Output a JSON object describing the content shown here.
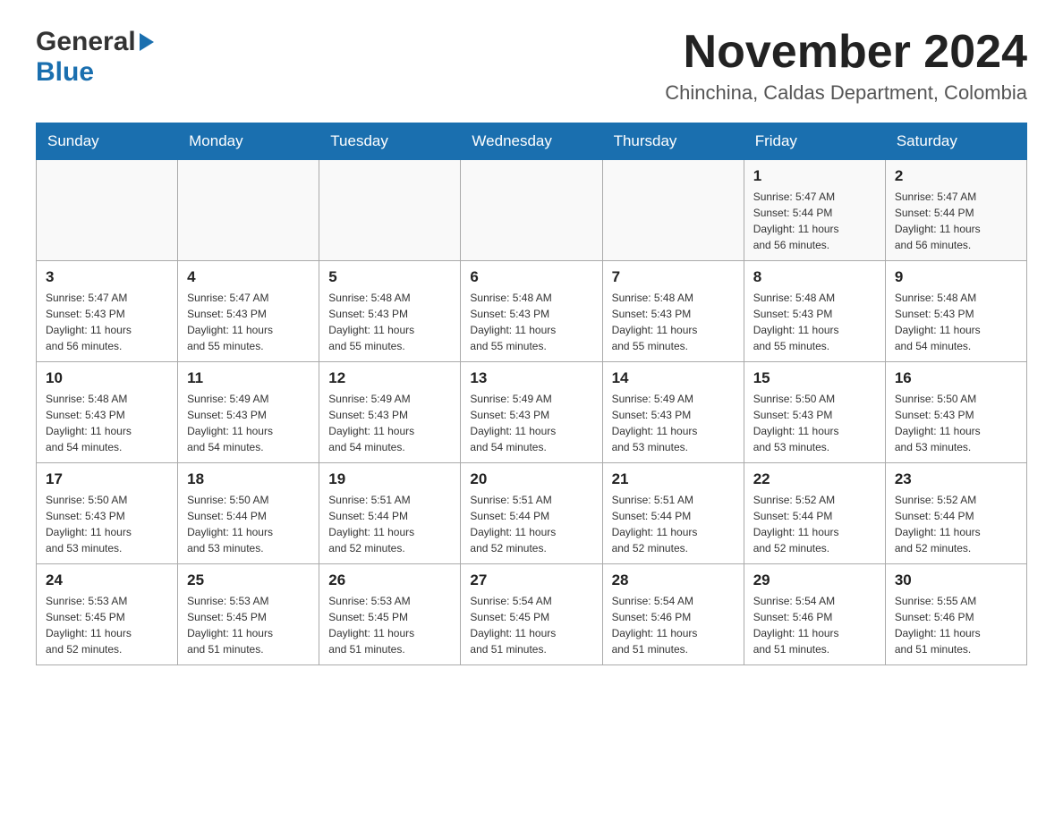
{
  "header": {
    "logo": {
      "general": "General",
      "blue": "Blue",
      "arrow": "▶"
    },
    "month_title": "November 2024",
    "location": "Chinchina, Caldas Department, Colombia"
  },
  "calendar": {
    "days_of_week": [
      "Sunday",
      "Monday",
      "Tuesday",
      "Wednesday",
      "Thursday",
      "Friday",
      "Saturday"
    ],
    "weeks": [
      [
        {
          "day": "",
          "info": ""
        },
        {
          "day": "",
          "info": ""
        },
        {
          "day": "",
          "info": ""
        },
        {
          "day": "",
          "info": ""
        },
        {
          "day": "",
          "info": ""
        },
        {
          "day": "1",
          "info": "Sunrise: 5:47 AM\nSunset: 5:44 PM\nDaylight: 11 hours\nand 56 minutes."
        },
        {
          "day": "2",
          "info": "Sunrise: 5:47 AM\nSunset: 5:44 PM\nDaylight: 11 hours\nand 56 minutes."
        }
      ],
      [
        {
          "day": "3",
          "info": "Sunrise: 5:47 AM\nSunset: 5:43 PM\nDaylight: 11 hours\nand 56 minutes."
        },
        {
          "day": "4",
          "info": "Sunrise: 5:47 AM\nSunset: 5:43 PM\nDaylight: 11 hours\nand 55 minutes."
        },
        {
          "day": "5",
          "info": "Sunrise: 5:48 AM\nSunset: 5:43 PM\nDaylight: 11 hours\nand 55 minutes."
        },
        {
          "day": "6",
          "info": "Sunrise: 5:48 AM\nSunset: 5:43 PM\nDaylight: 11 hours\nand 55 minutes."
        },
        {
          "day": "7",
          "info": "Sunrise: 5:48 AM\nSunset: 5:43 PM\nDaylight: 11 hours\nand 55 minutes."
        },
        {
          "day": "8",
          "info": "Sunrise: 5:48 AM\nSunset: 5:43 PM\nDaylight: 11 hours\nand 55 minutes."
        },
        {
          "day": "9",
          "info": "Sunrise: 5:48 AM\nSunset: 5:43 PM\nDaylight: 11 hours\nand 54 minutes."
        }
      ],
      [
        {
          "day": "10",
          "info": "Sunrise: 5:48 AM\nSunset: 5:43 PM\nDaylight: 11 hours\nand 54 minutes."
        },
        {
          "day": "11",
          "info": "Sunrise: 5:49 AM\nSunset: 5:43 PM\nDaylight: 11 hours\nand 54 minutes."
        },
        {
          "day": "12",
          "info": "Sunrise: 5:49 AM\nSunset: 5:43 PM\nDaylight: 11 hours\nand 54 minutes."
        },
        {
          "day": "13",
          "info": "Sunrise: 5:49 AM\nSunset: 5:43 PM\nDaylight: 11 hours\nand 54 minutes."
        },
        {
          "day": "14",
          "info": "Sunrise: 5:49 AM\nSunset: 5:43 PM\nDaylight: 11 hours\nand 53 minutes."
        },
        {
          "day": "15",
          "info": "Sunrise: 5:50 AM\nSunset: 5:43 PM\nDaylight: 11 hours\nand 53 minutes."
        },
        {
          "day": "16",
          "info": "Sunrise: 5:50 AM\nSunset: 5:43 PM\nDaylight: 11 hours\nand 53 minutes."
        }
      ],
      [
        {
          "day": "17",
          "info": "Sunrise: 5:50 AM\nSunset: 5:43 PM\nDaylight: 11 hours\nand 53 minutes."
        },
        {
          "day": "18",
          "info": "Sunrise: 5:50 AM\nSunset: 5:44 PM\nDaylight: 11 hours\nand 53 minutes."
        },
        {
          "day": "19",
          "info": "Sunrise: 5:51 AM\nSunset: 5:44 PM\nDaylight: 11 hours\nand 52 minutes."
        },
        {
          "day": "20",
          "info": "Sunrise: 5:51 AM\nSunset: 5:44 PM\nDaylight: 11 hours\nand 52 minutes."
        },
        {
          "day": "21",
          "info": "Sunrise: 5:51 AM\nSunset: 5:44 PM\nDaylight: 11 hours\nand 52 minutes."
        },
        {
          "day": "22",
          "info": "Sunrise: 5:52 AM\nSunset: 5:44 PM\nDaylight: 11 hours\nand 52 minutes."
        },
        {
          "day": "23",
          "info": "Sunrise: 5:52 AM\nSunset: 5:44 PM\nDaylight: 11 hours\nand 52 minutes."
        }
      ],
      [
        {
          "day": "24",
          "info": "Sunrise: 5:53 AM\nSunset: 5:45 PM\nDaylight: 11 hours\nand 52 minutes."
        },
        {
          "day": "25",
          "info": "Sunrise: 5:53 AM\nSunset: 5:45 PM\nDaylight: 11 hours\nand 51 minutes."
        },
        {
          "day": "26",
          "info": "Sunrise: 5:53 AM\nSunset: 5:45 PM\nDaylight: 11 hours\nand 51 minutes."
        },
        {
          "day": "27",
          "info": "Sunrise: 5:54 AM\nSunset: 5:45 PM\nDaylight: 11 hours\nand 51 minutes."
        },
        {
          "day": "28",
          "info": "Sunrise: 5:54 AM\nSunset: 5:46 PM\nDaylight: 11 hours\nand 51 minutes."
        },
        {
          "day": "29",
          "info": "Sunrise: 5:54 AM\nSunset: 5:46 PM\nDaylight: 11 hours\nand 51 minutes."
        },
        {
          "day": "30",
          "info": "Sunrise: 5:55 AM\nSunset: 5:46 PM\nDaylight: 11 hours\nand 51 minutes."
        }
      ]
    ]
  }
}
